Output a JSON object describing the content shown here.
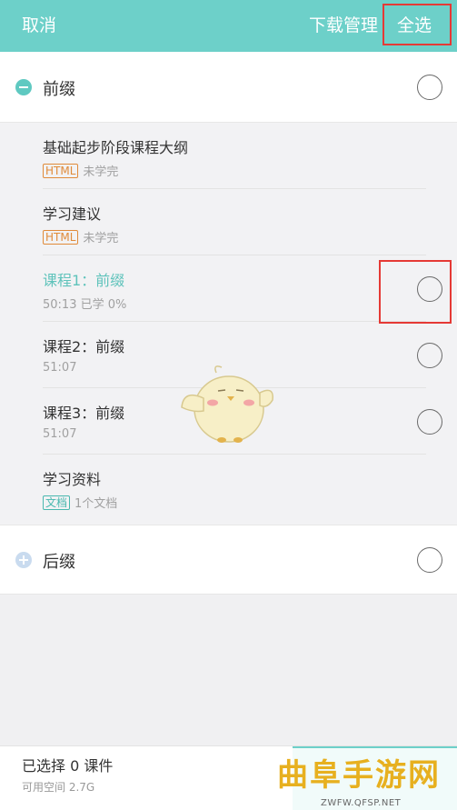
{
  "header": {
    "cancel_label": "取消",
    "download_manager_label": "下载管理",
    "select_all_label": "全选",
    "background_color": "#6dd0c9"
  },
  "sections": {
    "prefix": {
      "title": "前缀",
      "icon": "minus-circle-icon",
      "icon_color": "#5fc9c1"
    },
    "suffix": {
      "title": "后缀",
      "icon": "plus-circle-icon",
      "icon_color": "#c9dbef"
    }
  },
  "lessons": [
    {
      "title": "基础起步阶段课程大纲",
      "tag": "HTML",
      "meta": "未学完"
    },
    {
      "title": "学习建议",
      "tag": "HTML",
      "meta": "未学完"
    },
    {
      "title": "课程1：前缀",
      "meta": "50:13  已学 0%",
      "active": true
    },
    {
      "title": "课程2：前缀",
      "meta": "51:07"
    },
    {
      "title": "课程3：前缀",
      "meta": "51:07"
    },
    {
      "title": "学习资料",
      "tag": "文档",
      "meta": "1个文档"
    }
  ],
  "footer": {
    "selected_label": "已选择 0 课件",
    "space_label": "可用空间 2.7G"
  },
  "watermark": {
    "title": "曲阜手游网",
    "url": "ZWFW.QFSP.NET"
  },
  "colors": {
    "accent": "#6dd0c9",
    "highlight_box": "#e53935",
    "html_tag": "#e08b3a",
    "doc_tag": "#49b8af"
  }
}
